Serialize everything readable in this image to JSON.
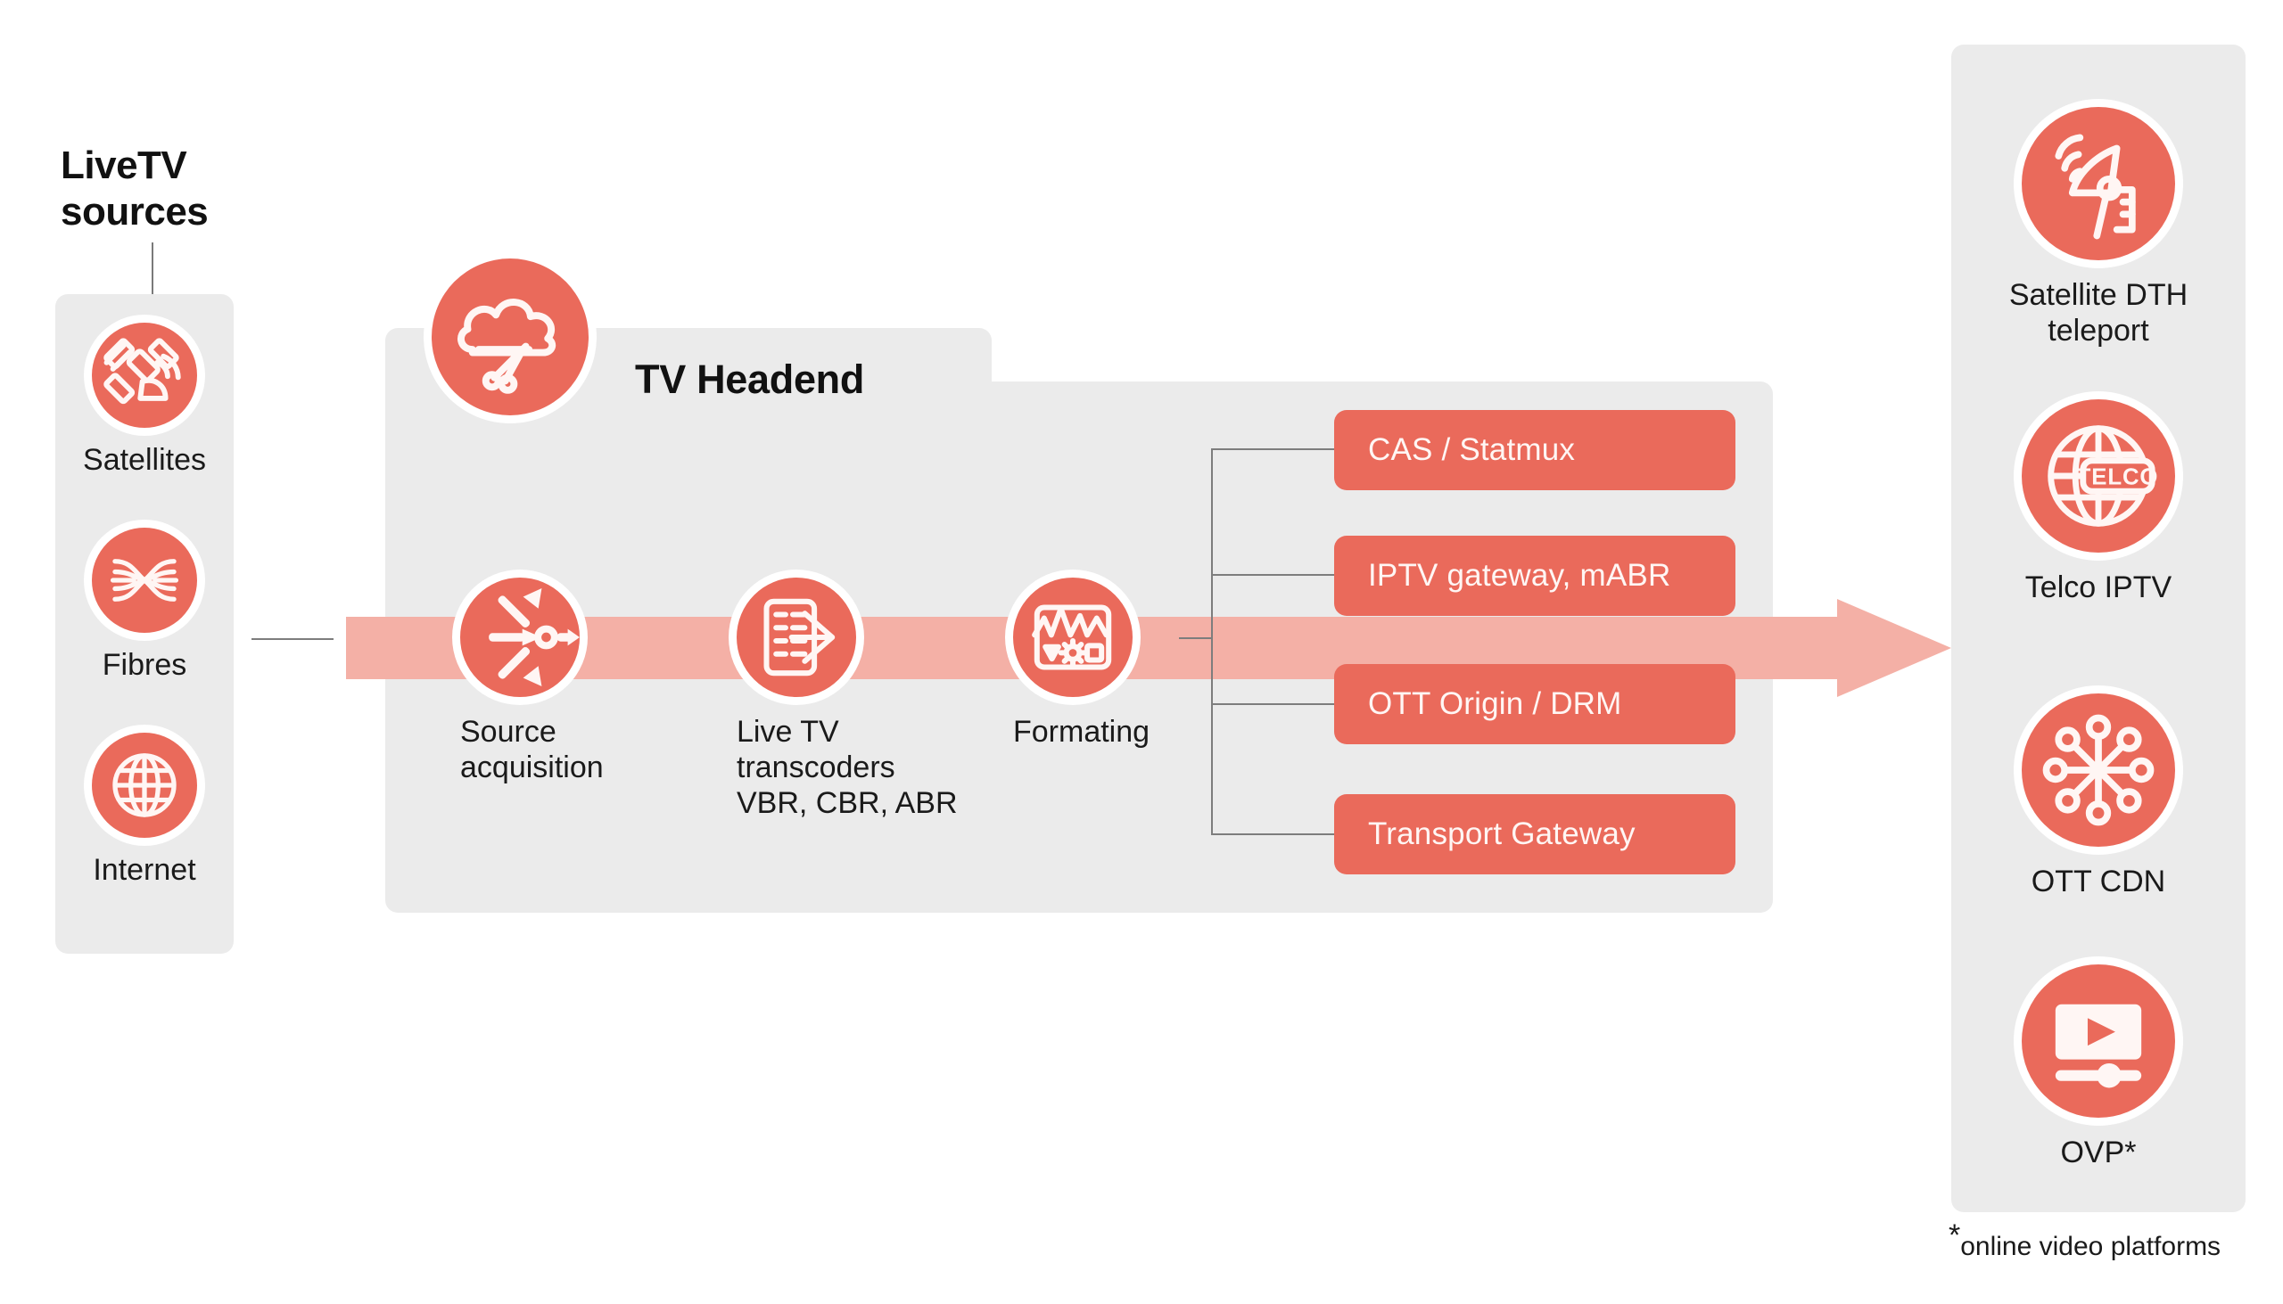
{
  "colors": {
    "accent_red": "#ea6a5b",
    "panel_grey": "#ebebeb",
    "arrow_pink": "#f4b0a6",
    "connector_grey": "#7d7d7d",
    "text_dark": "#1a1a1a",
    "pill_text": "#fff6f4"
  },
  "sources": {
    "title": "LiveTV\nsources",
    "title_line1": "LiveTV",
    "title_line2": "sources",
    "items": [
      {
        "label": "Satellites",
        "icon": "satellite-icon"
      },
      {
        "label": "Fibres",
        "icon": "fibre-optic-icon"
      },
      {
        "label": "Internet",
        "icon": "globe-icon"
      }
    ]
  },
  "headend": {
    "title": "TV Headend",
    "cloud_icon": "cloud-network-icon",
    "stages": [
      {
        "label": "Source\nacquisition",
        "icon": "source-acquisition-icon"
      },
      {
        "label": "Live TV\ntranscoders\nVBR, CBR, ABR",
        "icon": "transcoder-icon"
      },
      {
        "label": "Formating",
        "icon": "formating-icon"
      }
    ],
    "outputs": [
      {
        "label": "CAS / Statmux"
      },
      {
        "label": "IPTV gateway, mABR"
      },
      {
        "label": "OTT Origin / DRM"
      },
      {
        "label": "Transport Gateway"
      }
    ]
  },
  "destinations": {
    "items": [
      {
        "label": "Satellite DTH\nteleport",
        "icon": "satellite-dish-icon"
      },
      {
        "label": "Telco IPTV",
        "icon": "telco-globe-icon",
        "badge_text": "TELCO"
      },
      {
        "label": "OTT CDN",
        "icon": "cdn-network-icon"
      },
      {
        "label": "OVP*",
        "icon": "video-player-icon"
      }
    ]
  },
  "footnote": {
    "star": "*",
    "text": "online video platforms"
  }
}
